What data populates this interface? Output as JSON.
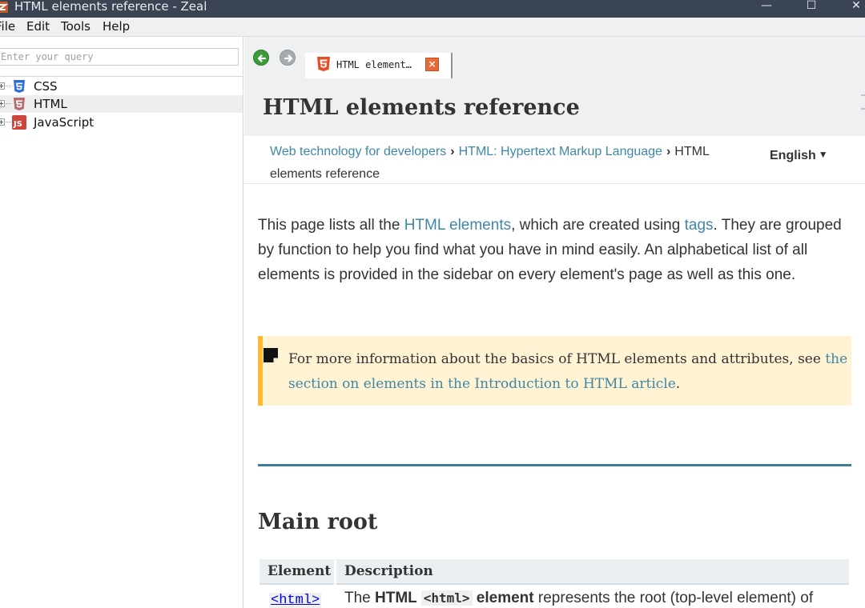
{
  "window": {
    "title": "HTML elements reference - Zeal",
    "minimize_glyph": "—",
    "maximize_glyph": "☐",
    "close_glyph": "✕"
  },
  "menu": {
    "items": [
      "File",
      "Edit",
      "Tools",
      "Help"
    ]
  },
  "sidebar": {
    "search_placeholder": "Enter your query",
    "search_value": "",
    "items": [
      {
        "label": "CSS",
        "icon": "css3-icon",
        "selected": false
      },
      {
        "label": "HTML",
        "icon": "html5-icon",
        "selected": true
      },
      {
        "label": "JavaScript",
        "icon": "javascript-icon",
        "selected": false
      }
    ]
  },
  "toolbar": {
    "back_icon": "back-arrow-icon",
    "forward_icon": "forward-arrow-icon"
  },
  "tab": {
    "label": "HTML element…",
    "icon": "html5-icon",
    "close_glyph": "×"
  },
  "page": {
    "title": "HTML elements reference",
    "breadcrumbs": {
      "link1": "Web technology for developers",
      "link2": "HTML: Hypertext Markup Language",
      "current": "HTML elements reference",
      "separator": "›"
    },
    "language": "English",
    "language_caret": "▼",
    "intro": {
      "part1": "This page lists all the ",
      "link1": "HTML elements",
      "part2": ", which are created using ",
      "link2": "tags",
      "part3": ". They are grouped by function to help you find what you have in mind easily. An alphabetical list of all elements is provided in the sidebar on every element's page as well as this one."
    },
    "note": {
      "text": "For more information about the basics of HTML elements and attributes, see ",
      "link": "the section on elements in the Introduction to HTML article",
      "end": "."
    },
    "section_heading": "Main root",
    "table": {
      "headers": [
        "Element",
        "Description"
      ],
      "row1": {
        "element": "<html>",
        "desc_pre": "The ",
        "desc_bold": "HTML ",
        "desc_code": "<html>",
        "desc_bold2": " element",
        "desc_post": " represents the root (top-level element) of"
      }
    }
  },
  "colors": {
    "titlebar": "#3a4453",
    "link": "#3f87a6",
    "note_bg": "#fff3d4",
    "note_border": "#ffb92f",
    "divider": "#3d7e9a",
    "css_icon": "#2f6ed8",
    "html_icon": "#e44d26",
    "js_icon": "#d0453b"
  }
}
